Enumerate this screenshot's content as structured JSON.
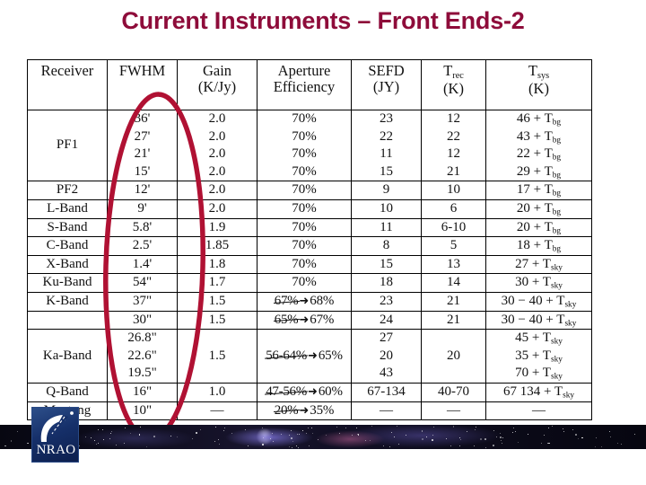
{
  "slide": {
    "title": "Current Instruments – Front Ends-2",
    "title_color": "#8e0c3a",
    "annotation_color": "#b01133"
  },
  "table": {
    "headers": [
      {
        "line1": "Receiver",
        "line2": ""
      },
      {
        "line1": "FWHM",
        "line2": ""
      },
      {
        "line1": "Gain",
        "line2": "(K/Jy)"
      },
      {
        "line1": "Aperture",
        "line2": "Efficiency"
      },
      {
        "line1": "SEFD",
        "line2": "(JY)"
      },
      {
        "line1": "Trec",
        "line2": "(K)"
      },
      {
        "line1": "Tsys",
        "line2": "(K)"
      }
    ],
    "rows": [
      {
        "receiver": "PF1",
        "fwhm": [
          "36'",
          "27'",
          "21'",
          "15'"
        ],
        "gain": [
          "2.0",
          "2.0",
          "2.0",
          "2.0"
        ],
        "aperture": [
          "70%",
          "70%",
          "70%",
          "70%"
        ],
        "sefd": [
          "23",
          "22",
          "11",
          "15"
        ],
        "trec": [
          "12",
          "22",
          "12",
          "21"
        ],
        "tsys": [
          "46 + Tbg",
          "43 + Tbg",
          "22 + Tbg",
          "29 + Tbg"
        ]
      },
      {
        "receiver": "PF2",
        "fwhm": [
          "12'"
        ],
        "gain": [
          "2.0"
        ],
        "aperture": [
          "70%"
        ],
        "sefd": [
          "9"
        ],
        "trec": [
          "10"
        ],
        "tsys": [
          "17 + Tbg"
        ]
      },
      {
        "receiver": "L-Band",
        "fwhm": [
          "9'"
        ],
        "gain": [
          "2.0"
        ],
        "aperture": [
          "70%"
        ],
        "sefd": [
          "10"
        ],
        "trec": [
          "6"
        ],
        "tsys": [
          "20 + Tbg"
        ]
      },
      {
        "receiver": "S-Band",
        "fwhm": [
          "5.8'"
        ],
        "gain": [
          "1.9"
        ],
        "aperture": [
          "70%"
        ],
        "sefd": [
          "11"
        ],
        "trec": [
          "6-10"
        ],
        "tsys": [
          "20 + Tbg"
        ]
      },
      {
        "receiver": "C-Band",
        "fwhm": [
          "2.5'"
        ],
        "gain": [
          "1.85"
        ],
        "aperture": [
          "70%"
        ],
        "sefd": [
          "8"
        ],
        "trec": [
          "5"
        ],
        "tsys": [
          "18 + Tbg"
        ]
      },
      {
        "receiver": "X-Band",
        "fwhm": [
          "1.4'"
        ],
        "gain": [
          "1.8"
        ],
        "aperture": [
          "70%"
        ],
        "sefd": [
          "15"
        ],
        "trec": [
          "13"
        ],
        "tsys": [
          "27 + Tsky"
        ]
      },
      {
        "receiver": "Ku-Band",
        "fwhm": [
          "54\""
        ],
        "gain": [
          "1.7"
        ],
        "aperture": [
          "70%"
        ],
        "sefd": [
          "18"
        ],
        "trec": [
          "14"
        ],
        "tsys": [
          "30 + Tsky"
        ]
      },
      {
        "receiver": "K-Band",
        "fwhm": [
          "37\""
        ],
        "gain": [
          "1.5"
        ],
        "aperture_edit": {
          "old": "67%",
          "new": "68%"
        },
        "sefd": [
          "23"
        ],
        "trec": [
          "21"
        ],
        "tsys": [
          "30 − 40 + Tsky"
        ]
      },
      {
        "receiver": "",
        "fwhm": [
          "30\""
        ],
        "gain": [
          "1.5"
        ],
        "aperture_edit": {
          "old": "65%",
          "new": "67%"
        },
        "sefd": [
          "24"
        ],
        "trec": [
          "21"
        ],
        "tsys": [
          "30 − 40 + Tsky"
        ]
      },
      {
        "receiver": "Ka-Band",
        "fwhm": [
          "26.8\"",
          "22.6\"",
          "19.5\""
        ],
        "gain": [
          "1.5"
        ],
        "aperture_edit": {
          "old": "56-64%",
          "new": "65%"
        },
        "sefd": [
          "27",
          "20",
          "43"
        ],
        "trec": [
          "20"
        ],
        "tsys": [
          "45 + Tsky",
          "35 + Tsky",
          "70 + Tsky"
        ]
      },
      {
        "receiver": "Q-Band",
        "fwhm": [
          "16\""
        ],
        "gain": [
          "1.0"
        ],
        "aperture_edit": {
          "old": "47-56%",
          "new": "60%"
        },
        "sefd": [
          "67-134"
        ],
        "trec": [
          "40-70"
        ],
        "tsys": [
          "67    134 + Tsky"
        ]
      },
      {
        "receiver": "Mustang",
        "fwhm": [
          "10\""
        ],
        "gain": [
          "—"
        ],
        "aperture_edit": {
          "old": "20%",
          "new": "35%"
        },
        "sefd": [
          "—"
        ],
        "trec": [
          "—"
        ],
        "tsys": [
          "—"
        ]
      }
    ]
  },
  "logo": {
    "label": "NRAO",
    "icon": "radio-dish-icon"
  }
}
